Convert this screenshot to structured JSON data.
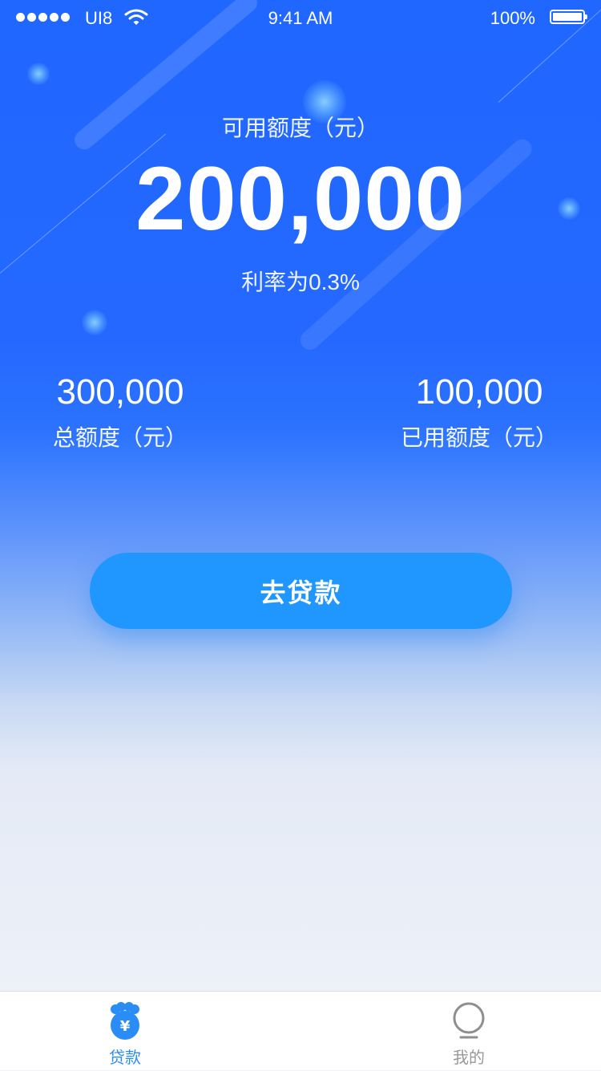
{
  "status_bar": {
    "carrier": "UI8",
    "time": "9:41 AM",
    "battery": "100%"
  },
  "credit": {
    "available_label": "可用额度（元）",
    "available_amount": "200,000",
    "rate_text": "利率为0.3%",
    "total_amount": "300,000",
    "total_label": "总额度（元）",
    "used_amount": "100,000",
    "used_label": "已用额度（元）"
  },
  "action": {
    "loan_button_label": "去贷款"
  },
  "tab_bar": {
    "items": [
      {
        "label": "贷款",
        "icon": "money-bag-icon",
        "active": true
      },
      {
        "label": "我的",
        "icon": "profile-icon",
        "active": false
      }
    ]
  },
  "colors": {
    "primary_blue": "#2067ff",
    "button_blue": "#1f97ff",
    "active_tab": "#2a8df6",
    "inactive_tab": "#999999"
  }
}
